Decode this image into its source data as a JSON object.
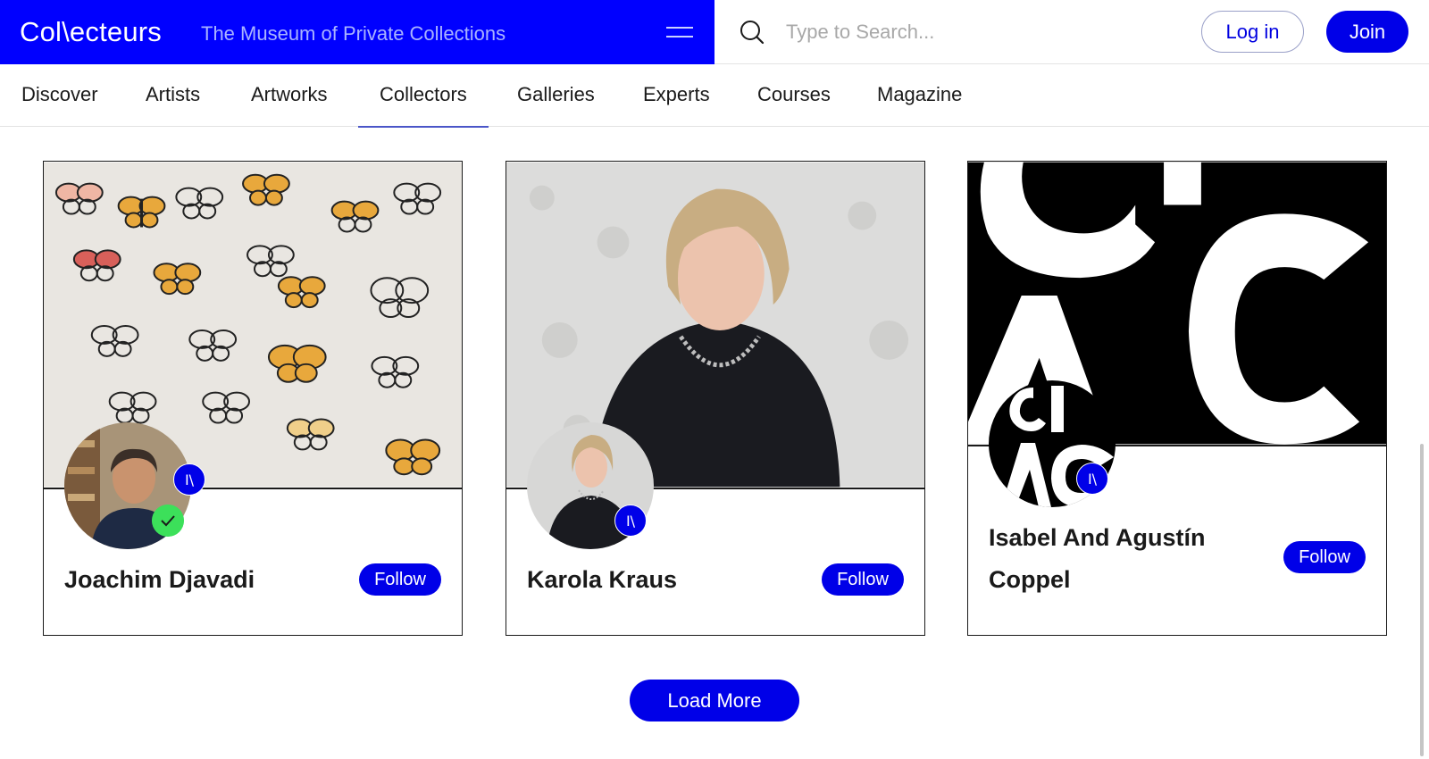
{
  "header": {
    "logo": "Col\\ecteurs",
    "tagline": "The Museum of Private Collections",
    "search_placeholder": "Type to Search...",
    "login_label": "Log in",
    "join_label": "Join"
  },
  "nav": {
    "items": [
      "Discover",
      "Artists",
      "Artworks",
      "Collectors",
      "Galleries",
      "Experts",
      "Courses",
      "Magazine"
    ],
    "active": "Collectors"
  },
  "collectors": [
    {
      "name": "Joachim Djavadi",
      "follow_label": "Follow",
      "badge": "I\\",
      "verified": true
    },
    {
      "name": "Karola Kraus",
      "follow_label": "Follow",
      "badge": "I\\",
      "verified": false
    },
    {
      "name_line1": "Isabel And Agustín",
      "name_line2": "Coppel",
      "follow_label": "Follow",
      "badge": "I\\",
      "verified": false
    }
  ],
  "load_more_label": "Load More",
  "colors": {
    "brand_blue": "#0000ff",
    "button_blue": "#0000e8",
    "tagline": "#aab4ff",
    "verified_green": "#3ce05a"
  }
}
